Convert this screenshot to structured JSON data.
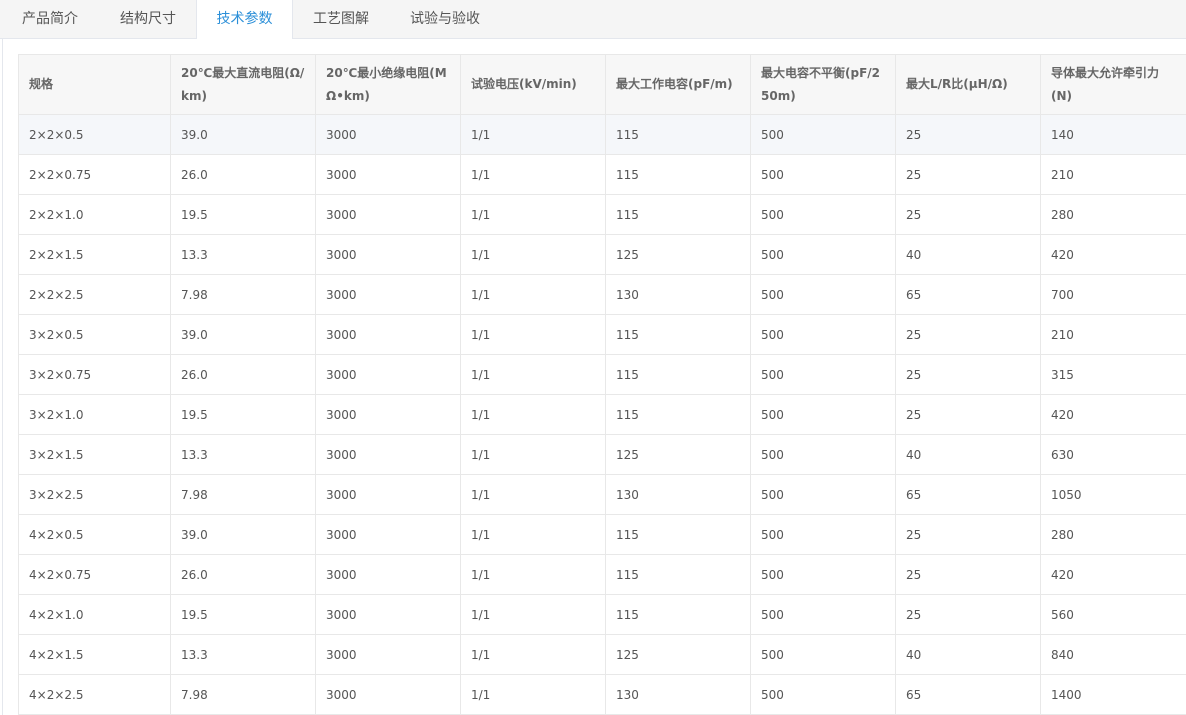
{
  "tabs": [
    {
      "label": "产品简介",
      "active": false
    },
    {
      "label": "结构尺寸",
      "active": false
    },
    {
      "label": "技术参数",
      "active": true
    },
    {
      "label": "工艺图解",
      "active": false
    },
    {
      "label": "试验与验收",
      "active": false
    }
  ],
  "colors": {
    "accent": "#2b8fd8",
    "border": "#e4e7ed",
    "header_bg": "#f7f7f7",
    "hover_row": "#f5f7fa"
  },
  "table": {
    "headers": [
      "规格",
      "20℃最大直流电阻(Ω/km)",
      "20℃最小绝缘电阻(MΩ•km)",
      "试验电压(kV/min)",
      "最大工作电容(pF/m)",
      "最大电容不平衡(pF/250m)",
      "最大L/R比(μH/Ω)",
      "导体最大允许牵引力(N)"
    ],
    "rows": [
      [
        "2×2×0.5",
        "39.0",
        "3000",
        "1/1",
        "115",
        "500",
        "25",
        "140"
      ],
      [
        "2×2×0.75",
        "26.0",
        "3000",
        "1/1",
        "115",
        "500",
        "25",
        "210"
      ],
      [
        "2×2×1.0",
        "19.5",
        "3000",
        "1/1",
        "115",
        "500",
        "25",
        "280"
      ],
      [
        "2×2×1.5",
        "13.3",
        "3000",
        "1/1",
        "125",
        "500",
        "40",
        "420"
      ],
      [
        "2×2×2.5",
        "7.98",
        "3000",
        "1/1",
        "130",
        "500",
        "65",
        "700"
      ],
      [
        "3×2×0.5",
        "39.0",
        "3000",
        "1/1",
        "115",
        "500",
        "25",
        "210"
      ],
      [
        "3×2×0.75",
        "26.0",
        "3000",
        "1/1",
        "115",
        "500",
        "25",
        "315"
      ],
      [
        "3×2×1.0",
        "19.5",
        "3000",
        "1/1",
        "115",
        "500",
        "25",
        "420"
      ],
      [
        "3×2×1.5",
        "13.3",
        "3000",
        "1/1",
        "125",
        "500",
        "40",
        "630"
      ],
      [
        "3×2×2.5",
        "7.98",
        "3000",
        "1/1",
        "130",
        "500",
        "65",
        "1050"
      ],
      [
        "4×2×0.5",
        "39.0",
        "3000",
        "1/1",
        "115",
        "500",
        "25",
        "280"
      ],
      [
        "4×2×0.75",
        "26.0",
        "3000",
        "1/1",
        "115",
        "500",
        "25",
        "420"
      ],
      [
        "4×2×1.0",
        "19.5",
        "3000",
        "1/1",
        "115",
        "500",
        "25",
        "560"
      ],
      [
        "4×2×1.5",
        "13.3",
        "3000",
        "1/1",
        "125",
        "500",
        "40",
        "840"
      ],
      [
        "4×2×2.5",
        "7.98",
        "3000",
        "1/1",
        "130",
        "500",
        "65",
        "1400"
      ]
    ]
  }
}
